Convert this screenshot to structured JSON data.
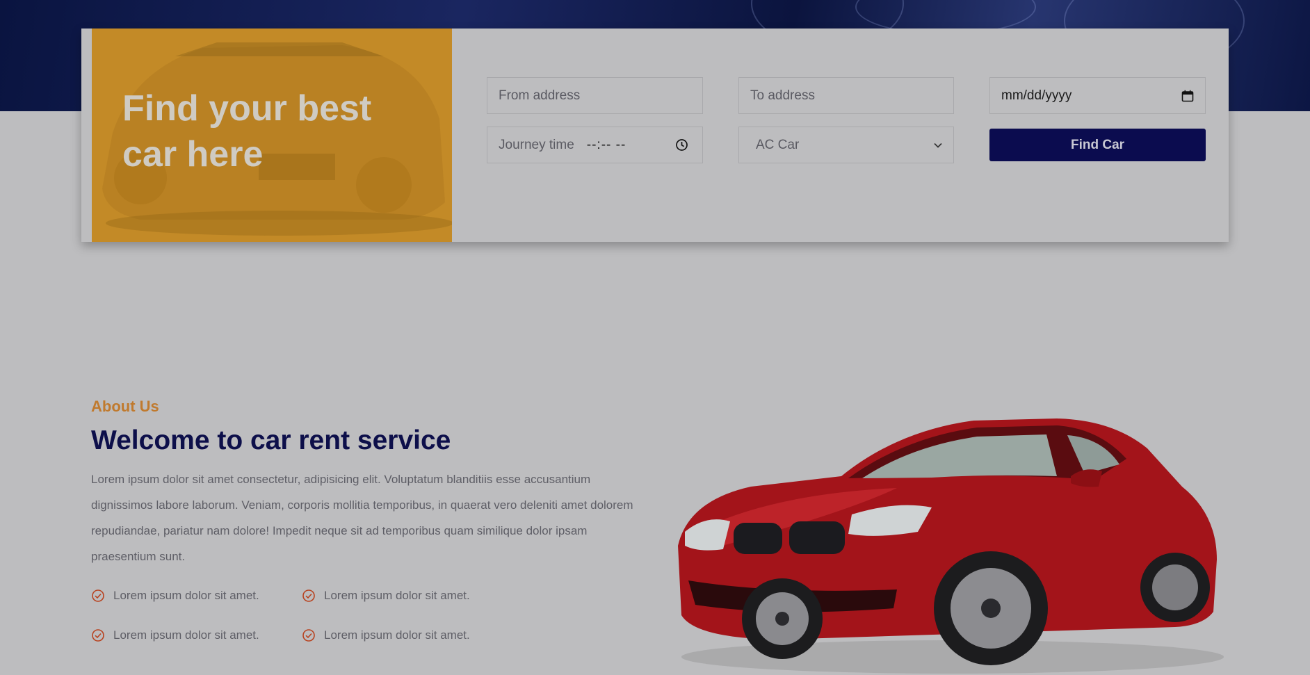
{
  "booking": {
    "promo_title": "Find your best car here",
    "from_placeholder": "From address",
    "to_placeholder": "To address",
    "date_value": "mm/dd/yyyy",
    "time_label": "Journey time",
    "time_value": "--:-- --",
    "car_type_selected": "AC Car",
    "find_button": "Find Car"
  },
  "about": {
    "eyebrow": "About Us",
    "title": "Welcome to car rent service",
    "body": "Lorem ipsum dolor sit amet consectetur, adipisicing elit. Voluptatum blanditiis esse accusantium dignissimos labore laborum. Veniam, corporis mollitia temporibus, in quaerat vero deleniti amet dolorem repudiandae, pariatur nam dolore! Impedit neque sit ad temporibus quam similique dolor ipsam praesentium sunt.",
    "features": [
      "Lorem ipsum dolor sit amet.",
      "Lorem ipsum dolor sit amet.",
      "Lorem ipsum dolor sit amet.",
      "Lorem ipsum dolor sit amet."
    ]
  },
  "icons": {
    "clock": "clock-icon",
    "calendar": "calendar-icon",
    "chevron": "chevron-down-icon",
    "check": "check-circle-icon"
  },
  "colors": {
    "navy": "#0b0c4f",
    "accent_orange": "#c07a2e",
    "promo_orange": "#c38a27",
    "check_red": "#b8421f",
    "car_red": "#a3141a"
  }
}
